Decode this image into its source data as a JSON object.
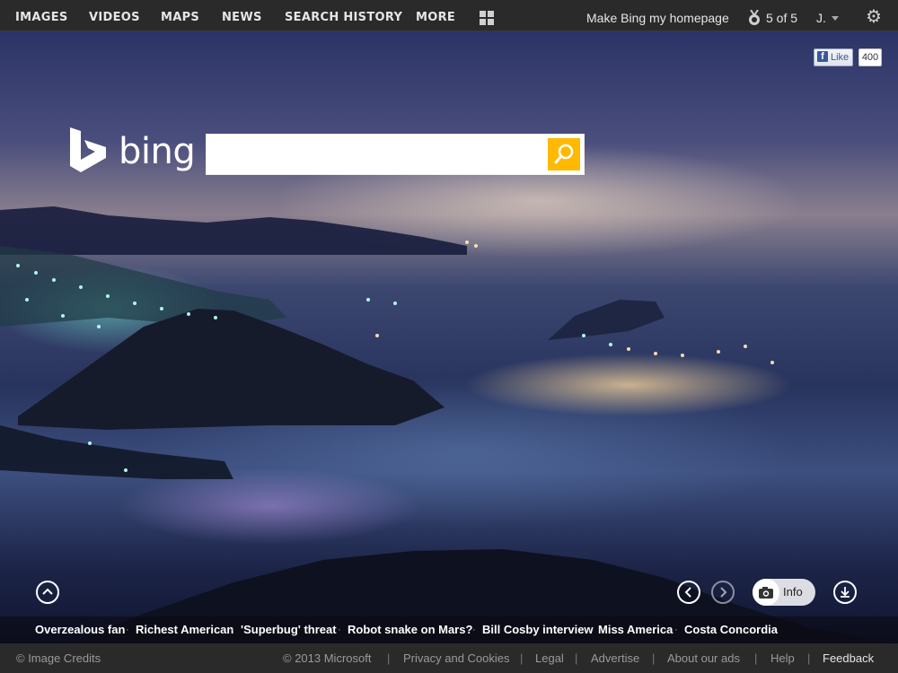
{
  "nav": {
    "images": "IMAGES",
    "videos": "VIDEOS",
    "maps": "MAPS",
    "news": "NEWS",
    "search_history": "SEARCH HISTORY",
    "more": "MORE"
  },
  "top_right": {
    "make_homepage": "Make Bing my homepage",
    "rewards_status": "5 of 5",
    "user_initial": "J."
  },
  "facebook": {
    "like_label": "Like",
    "like_count": "400"
  },
  "logo": {
    "text": "bing"
  },
  "search": {
    "value": "",
    "placeholder": ""
  },
  "bottom_controls": {
    "info_label": "Info"
  },
  "news_headlines": [
    "Overzealous fan",
    "Richest American",
    "'Superbug' threat",
    "Robot snake on Mars?",
    "Bill Cosby interview",
    "Miss America",
    "Costa Concordia"
  ],
  "footer": {
    "image_credits": "© Image Credits",
    "copyright": "© 2013 Microsoft",
    "privacy": "Privacy and Cookies",
    "legal": "Legal",
    "advertise": "Advertise",
    "about_ads": "About our ads",
    "help": "Help",
    "feedback": "Feedback"
  },
  "colors": {
    "top_bar": "#2a2a2a",
    "search_button": "#ffb900",
    "footer_bar": "#2a2a2a"
  }
}
